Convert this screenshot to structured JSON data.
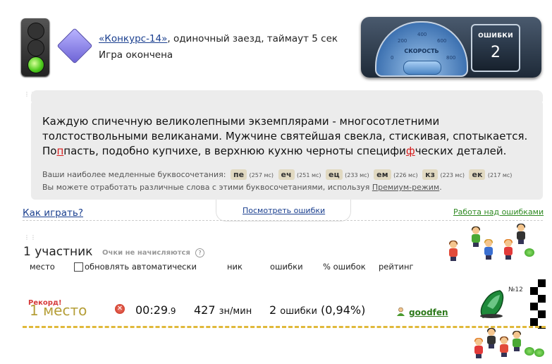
{
  "game": {
    "competition_link": "«Конкурс-14»",
    "description": ", одиночный заезд, таймаут 5 сек",
    "status": "Игра окончена"
  },
  "dashboard": {
    "speed_label": "СКОРОСТЬ",
    "ticks": [
      "0",
      "200",
      "400",
      "600",
      "800"
    ],
    "errors_label": "ОШИБКИ",
    "errors_value": "2"
  },
  "typed_text": {
    "part1": "Каждую спичечную великолепными экземплярами - многосотлетними толстоствольными великанами. Мужчине святейшая свекла, стискивая, спотыкается. По",
    "err1": "п",
    "part2": "пасть, подобно купчихе, в верхнюю кухню черноты специфи",
    "err2": "ф",
    "part3": "ческих деталей."
  },
  "slow_combos": {
    "label": "Ваши наиболее медленные буквосочетания:",
    "items": [
      {
        "combo": "пе",
        "time": "(257 мс)"
      },
      {
        "combo": "еч",
        "time": "(251 мс)"
      },
      {
        "combo": "ец",
        "time": "(233 мс)"
      },
      {
        "combo": "ем",
        "time": "(226 мс)"
      },
      {
        "combo": "кз",
        "time": "(223 мс)"
      },
      {
        "combo": "ек",
        "time": "(217 мс)"
      }
    ]
  },
  "practice": {
    "text": "Вы можете отработать различные слова с этими буквосочетаниями, используя ",
    "link": "Премиум-режим",
    "end": "."
  },
  "links": {
    "how_to_play": "Как играть?",
    "view_errors": "Посмотреть ошибки",
    "work_on_errors": "Работа над ошибками"
  },
  "participants": {
    "count_label": "1 участник",
    "no_points": "Очки не начисляются",
    "help": "?",
    "headers": {
      "place": "место",
      "auto_update": "обновлять автоматически",
      "nick": "ник",
      "errors": "ошибки",
      "error_pct": "% ошибок",
      "rating": "рейтинг"
    }
  },
  "result": {
    "record": "Рекорд!",
    "place": "1 место",
    "time_main": "00:29",
    "time_frac": ".9",
    "speed": "427",
    "speed_unit": "зн/мин",
    "errors_count": "2",
    "errors_unit": "ошибки",
    "errors_pct": "(0,94%)",
    "nick": "goodfen",
    "car_number": "№12"
  },
  "colors": {
    "accent_link": "#1a3f8f",
    "error_red": "#d61c1c",
    "record_gold": "#b59e37",
    "work_green": "#2f8a23"
  }
}
